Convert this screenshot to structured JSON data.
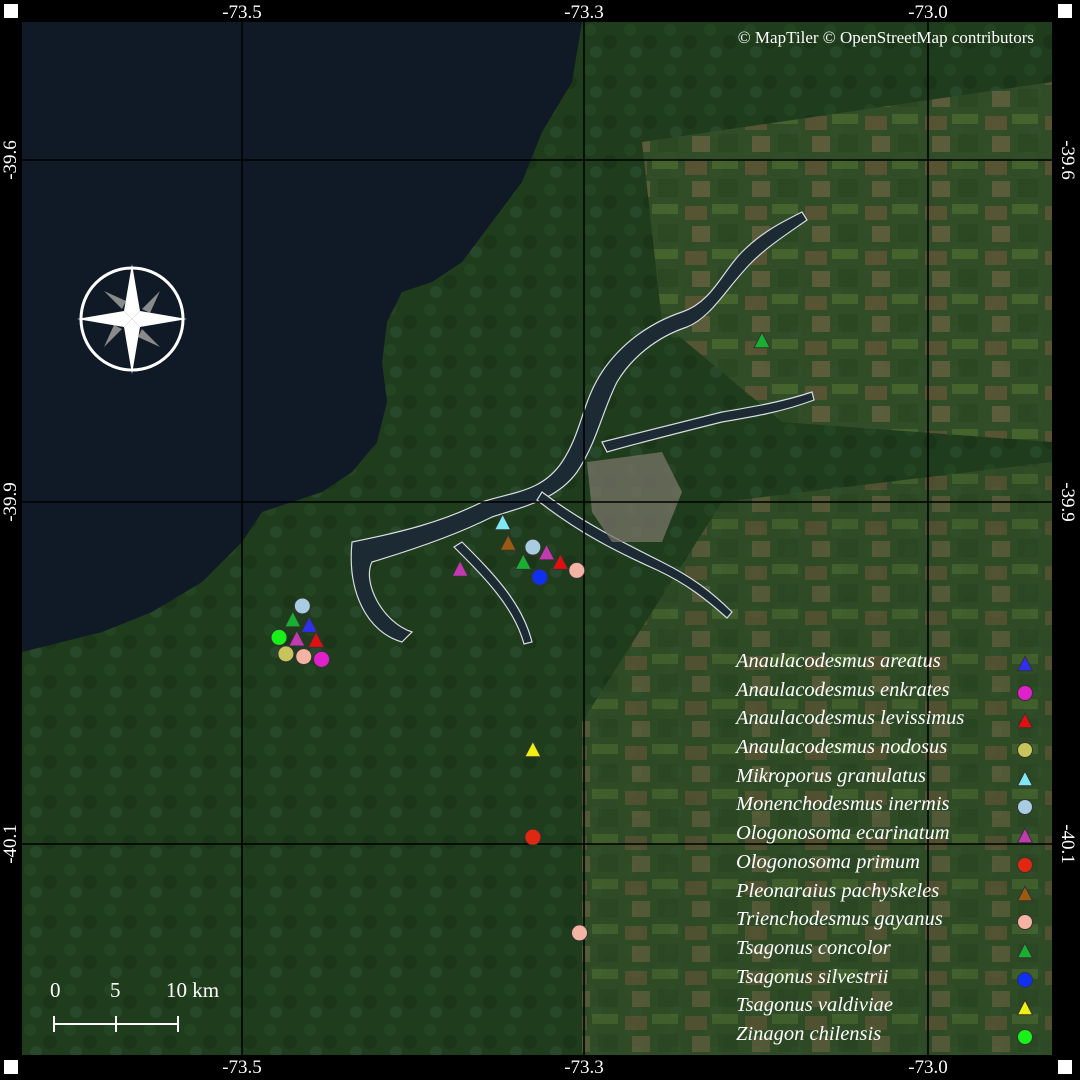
{
  "attribution": "© MapTiler  © OpenStreetMap contributors",
  "longitude_ticks": [
    "-73.5",
    "-73.3",
    "-73.0"
  ],
  "latitude_ticks": [
    "-39.6",
    "-39.9",
    "-40.1"
  ],
  "scale_bar": {
    "labels": [
      "0",
      "5",
      "10 km"
    ]
  },
  "compass": "compass-rose",
  "legend": [
    {
      "label": "Anaulacodesmus areatus",
      "shape": "triangle",
      "color": "#2f2ff0"
    },
    {
      "label": "Anaulacodesmus enkrates",
      "shape": "circle",
      "color": "#e020c8"
    },
    {
      "label": "Anaulacodesmus levissimus",
      "shape": "triangle",
      "color": "#e01010"
    },
    {
      "label": "Anaulacodesmus nodosus",
      "shape": "circle",
      "color": "#c6c45a"
    },
    {
      "label": "Mikroporus granulatus",
      "shape": "triangle",
      "color": "#7fe8f2"
    },
    {
      "label": "Monenchodesmus inermis",
      "shape": "circle",
      "color": "#a8cce0"
    },
    {
      "label": "Ologonosoma ecarinatum",
      "shape": "triangle",
      "color": "#c23ab0"
    },
    {
      "label": "Ologonosoma primum",
      "shape": "circle",
      "color": "#e02810"
    },
    {
      "label": "Pleonaraius pachyskeles",
      "shape": "triangle",
      "color": "#9a5a10"
    },
    {
      "label": "Trienchodesmus gayanus",
      "shape": "circle",
      "color": "#f4b4a4"
    },
    {
      "label": "Tsagonus concolor",
      "shape": "triangle",
      "color": "#18b030"
    },
    {
      "label": "Tsagonus silvestrii",
      "shape": "circle",
      "color": "#1030f0"
    },
    {
      "label": "Tsagonus valdiviae",
      "shape": "triangle",
      "color": "#f0f010"
    },
    {
      "label": "Zinagon chilensis",
      "shape": "circle",
      "color": "#18f018"
    }
  ],
  "records": [
    {
      "species": 4,
      "lon": -73.31,
      "lat": -39.865
    },
    {
      "species": 8,
      "lon": -73.306,
      "lat": -39.88
    },
    {
      "species": 5,
      "lon": -73.288,
      "lat": -39.883
    },
    {
      "species": 6,
      "lon": -73.278,
      "lat": -39.887
    },
    {
      "species": 10,
      "lon": -73.295,
      "lat": -39.894
    },
    {
      "species": 2,
      "lon": -73.268,
      "lat": -39.894
    },
    {
      "species": 9,
      "lon": -73.256,
      "lat": -39.9
    },
    {
      "species": 11,
      "lon": -73.283,
      "lat": -39.905
    },
    {
      "species": 6,
      "lon": -73.341,
      "lat": -39.899
    },
    {
      "species": 5,
      "lon": -73.456,
      "lat": -39.926
    },
    {
      "species": 10,
      "lon": -73.463,
      "lat": -39.936
    },
    {
      "species": 0,
      "lon": -73.451,
      "lat": -39.94
    },
    {
      "species": 13,
      "lon": -73.473,
      "lat": -39.949
    },
    {
      "species": 6,
      "lon": -73.46,
      "lat": -39.95
    },
    {
      "species": 2,
      "lon": -73.446,
      "lat": -39.951
    },
    {
      "species": 3,
      "lon": -73.468,
      "lat": -39.961
    },
    {
      "species": 9,
      "lon": -73.455,
      "lat": -39.963
    },
    {
      "species": 1,
      "lon": -73.442,
      "lat": -39.965
    },
    {
      "species": 12,
      "lon": -73.288,
      "lat": -40.031
    },
    {
      "species": 7,
      "lon": -73.288,
      "lat": -40.095
    },
    {
      "species": 9,
      "lon": -73.254,
      "lat": -40.165
    },
    {
      "species": 10,
      "lon": -73.121,
      "lat": -39.732
    }
  ]
}
